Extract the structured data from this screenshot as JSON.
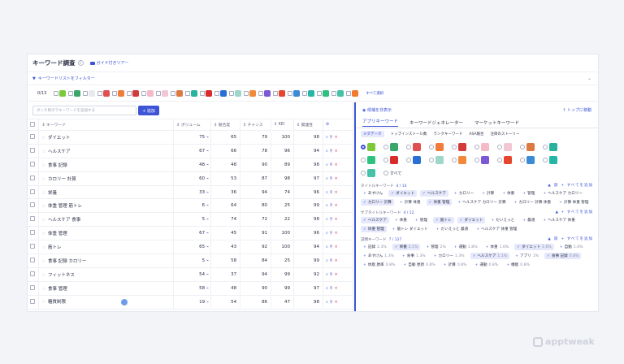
{
  "header": {
    "title": "キーワード調査",
    "guide_label": "ガイド付きツアー"
  },
  "filter": {
    "label": "キーワードリストをフィルター"
  },
  "apps_bar": {
    "count": "0/13",
    "select_all": "すべて選択",
    "app_icons": [
      {
        "name": "app-icon-1",
        "color": "#7ec93a"
      },
      {
        "name": "app-icon-2",
        "color": "#3aa66b"
      },
      {
        "name": "app-icon-3",
        "color": "#e8e8ef"
      },
      {
        "name": "app-icon-4",
        "color": "#e05050"
      },
      {
        "name": "app-icon-5",
        "color": "#f07c3a"
      },
      {
        "name": "app-icon-6",
        "color": "#d33b3b"
      },
      {
        "name": "app-icon-7",
        "color": "#f5b9c8"
      },
      {
        "name": "app-icon-8",
        "color": "#f3c6d3"
      },
      {
        "name": "app-icon-9",
        "color": "#dd7a42"
      },
      {
        "name": "app-icon-10",
        "color": "#28b39c"
      },
      {
        "name": "app-icon-11",
        "color": "#d92b2b"
      },
      {
        "name": "app-icon-12",
        "color": "#2a6fd8"
      },
      {
        "name": "app-icon-13",
        "color": "#9ed7c9"
      },
      {
        "name": "app-icon-14",
        "color": "#f08a3a"
      },
      {
        "name": "app-icon-15",
        "color": "#7c57d6"
      },
      {
        "name": "app-icon-16",
        "color": "#e4462e"
      },
      {
        "name": "app-icon-17",
        "color": "#3c8bd6"
      },
      {
        "name": "app-icon-18",
        "color": "#26b6a6"
      },
      {
        "name": "app-icon-19",
        "color": "#2ec27e"
      },
      {
        "name": "app-icon-20",
        "color": "#47c1a8"
      },
      {
        "name": "app-icon-21",
        "color": "#f07a2e"
      }
    ]
  },
  "search": {
    "placeholder": "ボンタ目ボラキーワードを追加する",
    "add_label": "+ 追加"
  },
  "table": {
    "headers": {
      "keyword": "キーワード",
      "volume": "ボリューム",
      "difficulty": "競合度",
      "chance": "チャンス",
      "kei": "KEI",
      "relevance": "関連性"
    },
    "rows": [
      {
        "keyword": "ダイエット",
        "volume": "75",
        "difficulty": "65",
        "chance": "79",
        "kei": "100",
        "relevance": "98"
      },
      {
        "keyword": "ヘルスケア",
        "volume": "67",
        "difficulty": "66",
        "chance": "78",
        "kei": "96",
        "relevance": "94"
      },
      {
        "keyword": "食事 記録",
        "volume": "48",
        "difficulty": "48",
        "chance": "90",
        "kei": "89",
        "relevance": "98"
      },
      {
        "keyword": "カロリー 計算",
        "volume": "60",
        "difficulty": "53",
        "chance": "87",
        "kei": "98",
        "relevance": "97"
      },
      {
        "keyword": "栄養",
        "volume": "33",
        "difficulty": "36",
        "chance": "94",
        "kei": "74",
        "relevance": "96"
      },
      {
        "keyword": "体重 管理 筋トレ",
        "volume": "6",
        "difficulty": "64",
        "chance": "80",
        "kei": "25",
        "relevance": "99"
      },
      {
        "keyword": "ヘルスケア 食事",
        "volume": "5",
        "difficulty": "74",
        "chance": "72",
        "kei": "22",
        "relevance": "98"
      },
      {
        "keyword": "体重 管理",
        "volume": "67",
        "difficulty": "45",
        "chance": "91",
        "kei": "100",
        "relevance": "96"
      },
      {
        "keyword": "筋トレ",
        "volume": "65",
        "difficulty": "43",
        "chance": "92",
        "kei": "100",
        "relevance": "94"
      },
      {
        "keyword": "食事 記録 カロリー",
        "volume": "5",
        "difficulty": "58",
        "chance": "84",
        "kei": "25",
        "relevance": "99"
      },
      {
        "keyword": "フィットネス",
        "volume": "54",
        "difficulty": "37",
        "chance": "94",
        "kei": "99",
        "relevance": "92"
      },
      {
        "keyword": "食事 管理",
        "volume": "58",
        "difficulty": "48",
        "chance": "90",
        "kei": "99",
        "relevance": "97"
      },
      {
        "keyword": "糖質制限",
        "volume": "19",
        "difficulty": "54",
        "chance": "86",
        "kei": "47",
        "relevance": "98"
      }
    ]
  },
  "right_panel": {
    "suggest_label": "候補を非表示",
    "top_link": "トップに移動",
    "tabs": [
      "アプリキーワード",
      "キーワードジェネレーター",
      "マーケットキーワード"
    ],
    "subtabs": [
      "メタデータ",
      "トップインストール数",
      "ランクキーワード",
      "ASA競合",
      "注目のストーリー"
    ],
    "all_label": "すべて",
    "grid_colors": [
      "#7ec93a",
      "#3aa66b",
      "#e05050",
      "#f07c3a",
      "#d33b3b",
      "#f5b9c8",
      "#f3c6d3",
      "#dd7a42",
      "#28b39c",
      "#2ec27e",
      "#d92b2b",
      "#2a6fd8",
      "#9ed7c9",
      "#f08a3a",
      "#7c57d6",
      "#e4462e",
      "#3c8bd6",
      "#26b6a6",
      "#47c1a8"
    ],
    "title_section": {
      "label": "タイトルキーワード",
      "count": "4 / 14",
      "add_all": "+ すべてを追加",
      "chips": [
        {
          "t": "あすけん",
          "on": false
        },
        {
          "t": "ダイエット",
          "on": true
        },
        {
          "t": "ヘルスケア",
          "on": true
        },
        {
          "t": "カロリー",
          "on": false
        },
        {
          "t": "計算",
          "on": false
        },
        {
          "t": "体重",
          "on": false
        },
        {
          "t": "管理",
          "on": false
        },
        {
          "t": "ヘルスケア カロリー",
          "on": false
        },
        {
          "t": "カロリー 計算",
          "on": true
        },
        {
          "t": "計算 体重",
          "on": false
        },
        {
          "t": "体重 管理",
          "on": true
        },
        {
          "t": "ヘルスケア カロリー 計算",
          "on": false
        },
        {
          "t": "カロリー 計算 体重",
          "on": false
        },
        {
          "t": "計算 体重 管理",
          "on": false
        }
      ]
    },
    "subtitle_section": {
      "label": "サブタイトルキーワード",
      "count": "4 / 12",
      "add_all": "+ すべてを追加",
      "chips": [
        {
          "t": "ヘルスケア",
          "on": true
        },
        {
          "t": "体重",
          "on": false
        },
        {
          "t": "管理",
          "on": false
        },
        {
          "t": "筋トレ",
          "on": true
        },
        {
          "t": "ダイエット",
          "on": true
        },
        {
          "t": "だいえっと",
          "on": false
        },
        {
          "t": "最適",
          "on": false
        },
        {
          "t": "ヘルスケア 体重",
          "on": false
        },
        {
          "t": "体重 管理",
          "on": true
        },
        {
          "t": "筋トレ ダイエット",
          "on": false
        },
        {
          "t": "だいえっと 最適",
          "on": false
        },
        {
          "t": "ヘルスケア 体重 管理",
          "on": false
        }
      ]
    },
    "desc_section": {
      "label": "説明キーワード",
      "count": "7 / 127",
      "add_all": "+ すべてを追加",
      "chips": [
        {
          "t": "記録",
          "p": "2.3%",
          "on": false
        },
        {
          "t": "栄養",
          "p": "2.1%",
          "on": true
        },
        {
          "t": "管理",
          "p": "2%",
          "on": false
        },
        {
          "t": "運動",
          "p": "1.8%",
          "on": false
        },
        {
          "t": "体重",
          "p": "1.6%",
          "on": false
        },
        {
          "t": "ダイエット",
          "p": "1.6%",
          "on": true
        },
        {
          "t": "自動",
          "p": "1.6%",
          "on": false
        },
        {
          "t": "あすけん",
          "p": "1.3%",
          "on": false
        },
        {
          "t": "食事",
          "p": "1.3%",
          "on": false
        },
        {
          "t": "カロリー",
          "p": "1.3%",
          "on": false
        },
        {
          "t": "ヘルスケア",
          "p": "1.1%",
          "on": true
        },
        {
          "t": "アプリ",
          "p": "1%",
          "on": false
        },
        {
          "t": "食事 記録",
          "p": "0.8%",
          "on": true
        },
        {
          "t": "体脂 肪率",
          "p": "0.8%",
          "on": false
        },
        {
          "t": "自動 更新",
          "p": "0.8%",
          "on": false
        },
        {
          "t": "計算",
          "p": "0.8%",
          "on": false
        },
        {
          "t": "運動",
          "p": "0.8%",
          "on": false
        },
        {
          "t": "機能",
          "p": "0.8%",
          "on": false
        }
      ]
    }
  },
  "brand": {
    "text": "apptweak"
  }
}
